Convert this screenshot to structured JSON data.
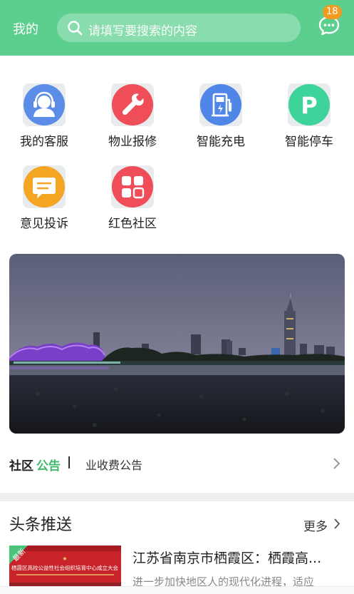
{
  "header": {
    "me_label": "我的",
    "search_placeholder": "请填写要搜索的内容",
    "message_badge": "18",
    "bg_color": "#5ccf8f"
  },
  "services": [
    {
      "label": "我的客服",
      "icon": "customer-service-icon",
      "color": "#5b8de8"
    },
    {
      "label": "物业报修",
      "icon": "wrench-icon",
      "color": "#ef4d57"
    },
    {
      "label": "智能充电",
      "icon": "charging-icon",
      "color": "#4f86e8"
    },
    {
      "label": "智能停车",
      "icon": "parking-icon",
      "color": "#3ed39a"
    },
    {
      "label": "意见投诉",
      "icon": "feedback-icon",
      "color": "#f5a524"
    },
    {
      "label": "红色社区",
      "icon": "grid-apps-icon",
      "color": "#ef4d57"
    }
  ],
  "notice": {
    "prefix_a": "社区",
    "prefix_b": "公告",
    "separator": "|",
    "text": "业收费公告"
  },
  "headlines": {
    "title": "头条推送",
    "more": "更多",
    "news": {
      "tag": "最新",
      "title": "江苏省南京市栖霞区：栖霞高...",
      "summary": "进一步加快地区人的现代化进程，适应",
      "image_caption": "栖霞区高校公益性社会组织培育中心成立大会"
    }
  }
}
